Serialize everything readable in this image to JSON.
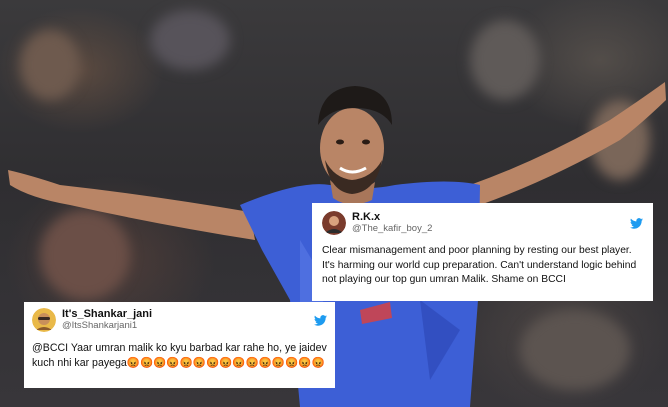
{
  "tweets": [
    {
      "name": "R.K.x",
      "handle": "@The_kafir_boy_2",
      "text": "Clear mismanagement and poor planning by resting our best player. It's harming our world cup preparation. Can't understand logic behind not playing our top gun umran Malik. Shame on BCCI",
      "icon": "twitter-bird-icon"
    },
    {
      "name": "It's_Shankar_jani",
      "handle": "@ItsShankarjani1",
      "text": "@BCCI Yaar umran malik ko kyu barbad kar rahe ho, ye jaidev kuch nhi kar payega😡😡😡😡😡😡😡😡😡😡😡😡😡😡😡",
      "icon": "twitter-bird-icon"
    }
  ],
  "colors": {
    "twitter_blue": "#1d9bf0",
    "jersey_blue": "#3d5fd6",
    "background": "#333135"
  }
}
